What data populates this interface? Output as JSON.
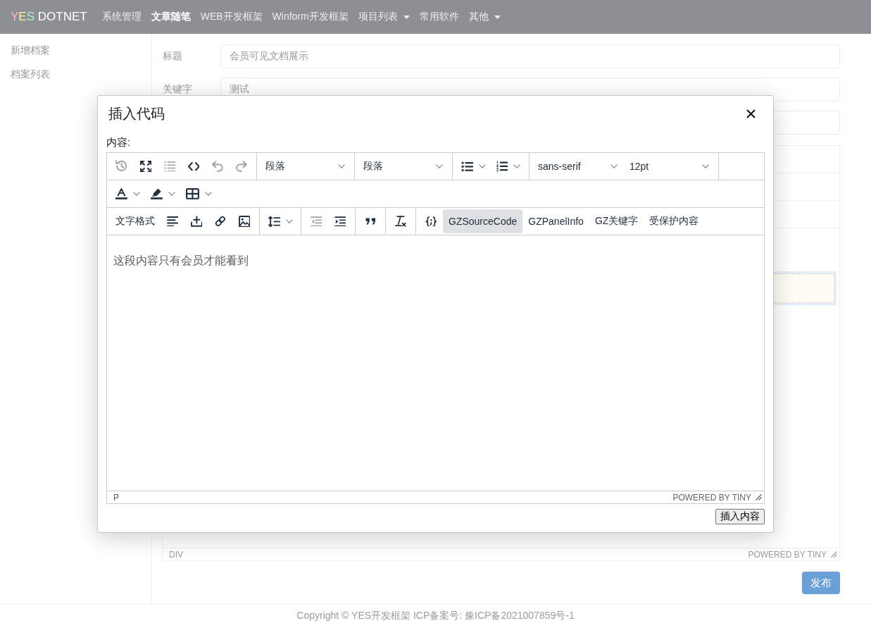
{
  "navbar": {
    "brand": "YES DOTNET",
    "items": [
      {
        "label": "系统管理",
        "selected": false,
        "dropdown": false
      },
      {
        "label": "文章随笔",
        "selected": true,
        "dropdown": false
      },
      {
        "label": "WEB开发框架",
        "selected": false,
        "dropdown": false
      },
      {
        "label": "Winform开发框架",
        "selected": false,
        "dropdown": false
      },
      {
        "label": "项目列表",
        "selected": false,
        "dropdown": true
      },
      {
        "label": "常用软件",
        "selected": false,
        "dropdown": false
      },
      {
        "label": "其他",
        "selected": false,
        "dropdown": true
      }
    ]
  },
  "sidebar": {
    "items": [
      {
        "label": "新增档案",
        "selected": false
      },
      {
        "label": "档案列表",
        "selected": false
      }
    ]
  },
  "form": {
    "fields": [
      {
        "label": "标题",
        "value": "会员可见文档展示"
      },
      {
        "label": "关键字",
        "value": "测试"
      }
    ],
    "editor": {
      "status_path": "DIV",
      "branding": "POWERED BY TINY"
    },
    "publish_button": "发布"
  },
  "dialog": {
    "title": "插入代码",
    "content_label": "内容:",
    "editor": {
      "toolbar": [
        [
          {
            "buttons": [
              {
                "kind": "icon",
                "disabled": true,
                "active": false
              },
              {
                "kind": "icon",
                "disabled": false,
                "active": false
              },
              {
                "kind": "icon",
                "disabled": true,
                "active": false
              },
              {
                "kind": "icon",
                "disabled": false,
                "active": false
              },
              {
                "kind": "icon",
                "disabled": true,
                "active": false
              },
              {
                "kind": "icon",
                "disabled": true,
                "active": false
              }
            ]
          },
          {
            "buttons": [
              {
                "kind": "select",
                "value": "段落",
                "disabled": false,
                "active": false
              }
            ]
          },
          {
            "buttons": [
              {
                "kind": "select",
                "value": "段落",
                "disabled": false,
                "active": false
              }
            ]
          },
          {
            "buttons": [
              {
                "kind": "split",
                "disabled": false,
                "active": false
              },
              {
                "kind": "split",
                "disabled": false,
                "active": false
              }
            ]
          },
          {
            "buttons": [
              {
                "kind": "select",
                "value": "sans-serif",
                "disabled": false,
                "active": false
              },
              {
                "kind": "select",
                "value": "12pt",
                "disabled": false,
                "active": false
              }
            ]
          }
        ],
        [
          {
            "buttons": [
              {
                "kind": "split",
                "disabled": false,
                "active": false
              },
              {
                "kind": "split",
                "disabled": false,
                "active": false
              },
              {
                "kind": "split",
                "disabled": false,
                "active": false
              }
            ]
          }
        ],
        [
          {
            "buttons": [
              {
                "kind": "menu",
                "label": "文字格式",
                "disabled": false,
                "active": false
              },
              {
                "kind": "icon",
                "disabled": false,
                "active": false
              },
              {
                "kind": "icon",
                "disabled": false,
                "active": false
              },
              {
                "kind": "icon",
                "disabled": false,
                "active": false
              },
              {
                "kind": "icon",
                "disabled": false,
                "active": false
              }
            ]
          },
          {
            "buttons": [
              {
                "kind": "split",
                "disabled": false,
                "active": false
              }
            ]
          },
          {
            "buttons": [
              {
                "kind": "icon",
                "disabled": true,
                "active": false
              },
              {
                "kind": "icon",
                "disabled": false,
                "active": false
              }
            ]
          },
          {
            "buttons": [
              {
                "kind": "icon",
                "disabled": false,
                "active": false
              }
            ]
          },
          {
            "buttons": [
              {
                "kind": "icon",
                "disabled": false,
                "active": false
              }
            ]
          },
          {
            "buttons": [
              {
                "kind": "icon",
                "disabled": false,
                "active": false
              },
              {
                "kind": "text",
                "label": "GZSourceCode",
                "disabled": false,
                "active": true
              },
              {
                "kind": "text",
                "label": "GZPanelInfo",
                "disabled": false,
                "active": false
              },
              {
                "kind": "text",
                "label": "GZ关键字",
                "disabled": false,
                "active": false
              },
              {
                "kind": "text",
                "label": "受保护内容",
                "disabled": false,
                "active": false
              }
            ]
          }
        ]
      ],
      "content": "这段内容只有会员才能看到",
      "status_path": "P",
      "branding": "POWERED BY TINY"
    },
    "insert_button": "插入内容"
  },
  "footer": "Copyright © YES开发框架 ICP备案号: 豫ICP备2021007859号-1"
}
